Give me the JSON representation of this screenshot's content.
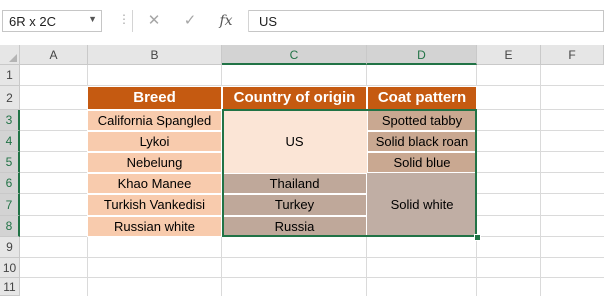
{
  "name_box": {
    "value": "6R x 2C",
    "dropdown_icon": "chevron-down-icon"
  },
  "formula_bar": {
    "cancel_icon": "close-icon",
    "enter_icon": "check-icon",
    "fx_label": "fx",
    "value": "US"
  },
  "columns": [
    "A",
    "B",
    "C",
    "D",
    "E",
    "F"
  ],
  "rows": [
    "1",
    "2",
    "3",
    "4",
    "5",
    "6",
    "7",
    "8",
    "9",
    "10",
    "11"
  ],
  "table": {
    "headers": {
      "breed": "Breed",
      "country": "Country of origin",
      "coat": "Coat pattern"
    },
    "breeds": [
      "California Spangled",
      "Lykoi",
      "Nebelung",
      "Khao Manee",
      "Turkish Vankedisi",
      "Russian white"
    ],
    "countries": {
      "us_merged": "US",
      "thailand": "Thailand",
      "turkey": "Turkey",
      "russia": "Russia"
    },
    "coats": {
      "spotted_tabby": "Spotted tabby",
      "solid_black_roan": "Solid black roan",
      "solid_blue": "Solid blue",
      "solid_white_merged": "Solid white"
    }
  },
  "colors": {
    "header_fill": "#c55a11",
    "breed_fill": "#f8cbad",
    "selection_border": "#217346"
  }
}
